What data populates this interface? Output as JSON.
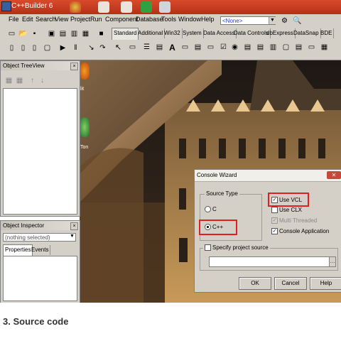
{
  "window": {
    "title": "C++Builder 6"
  },
  "menu": [
    "File",
    "Edit",
    "Search",
    "View",
    "Project",
    "Run",
    "Component",
    "Database",
    "Tools",
    "Window",
    "Help"
  ],
  "component_combo": {
    "value": "<None>"
  },
  "palette_tabs": [
    "Standard",
    "Additional",
    "Win32",
    "System",
    "Data Access",
    "Data Controls",
    "dbExpress",
    "DataSnap",
    "BDE"
  ],
  "palette_active_tab": "Standard",
  "tree_view": {
    "title": "Object TreeView"
  },
  "inspector": {
    "title": "Object Inspector",
    "selection": "(nothing selected)",
    "tabs": [
      "Properties",
      "Events"
    ]
  },
  "desktop_icons": [
    {
      "label": "lit",
      "icon": "browser-icon"
    },
    {
      "label": "Ton",
      "icon": "globe-icon"
    }
  ],
  "dialog": {
    "title": "Console Wizard",
    "source_type_label": "Source Type",
    "source_options": [
      {
        "label": "C",
        "selected": false
      },
      {
        "label": "C++",
        "selected": true
      }
    ],
    "checkboxes": [
      {
        "label": "Use VCL",
        "checked": true,
        "disabled": false
      },
      {
        "label": "Use CLX",
        "checked": false,
        "disabled": false
      },
      {
        "label": "Multi Threaded",
        "checked": true,
        "disabled": true
      },
      {
        "label": "Console Application",
        "checked": true,
        "disabled": false
      }
    ],
    "specify_source_label": "Specify project source",
    "source_path_value": "",
    "buttons": {
      "ok": "OK",
      "cancel": "Cancel",
      "help": "Help"
    }
  },
  "caption": "3. Source code",
  "colors": {
    "titlebar": "#c03a1f",
    "highlight_box": "#e02020",
    "ide_face": "#d4d0c8"
  }
}
